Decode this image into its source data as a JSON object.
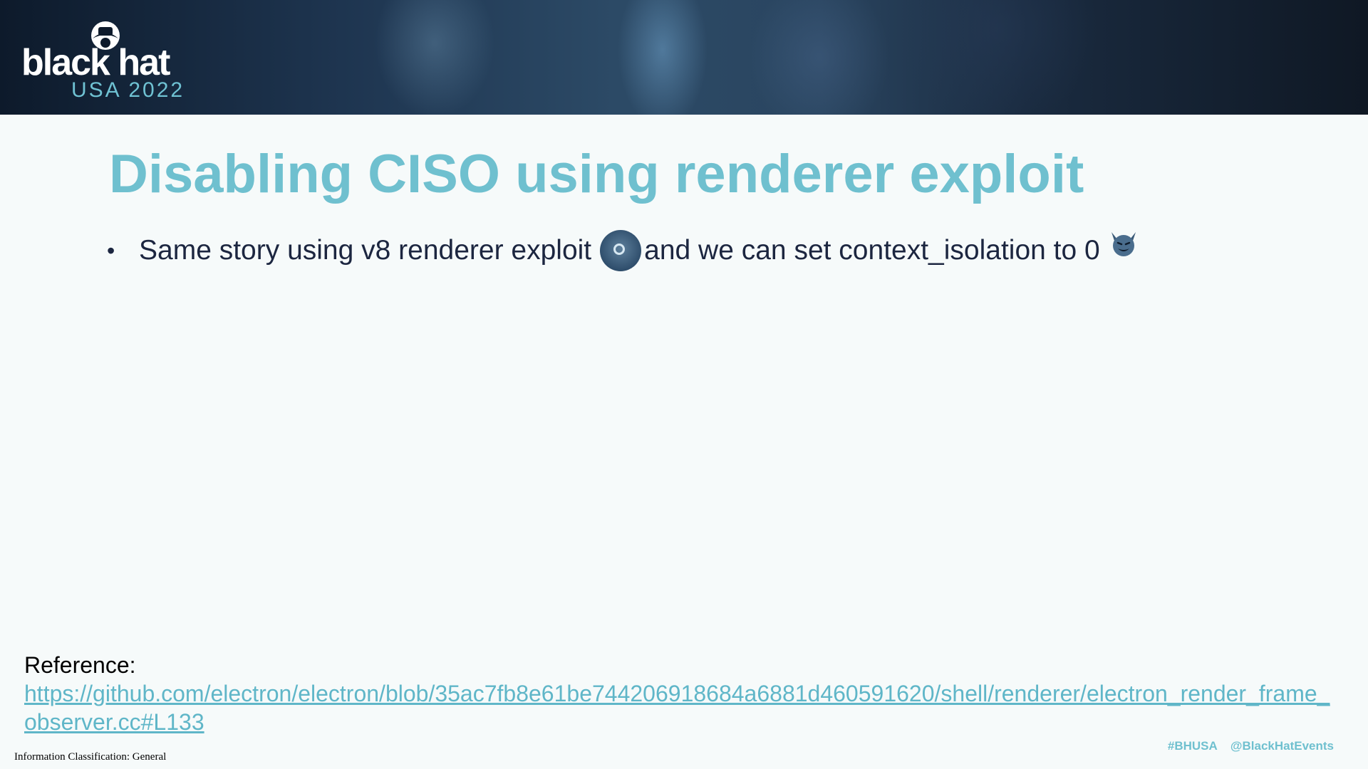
{
  "banner": {
    "logo_word": "black hat",
    "logo_sub": "USA 2022"
  },
  "slide": {
    "title": "Disabling CISO using renderer exploit",
    "bullet": {
      "text_before": "Same story using v8 renderer exploit",
      "text_after": "and we can set context_isolation to 0",
      "icons": [
        "record-button-icon",
        "smiling-devil-icon"
      ]
    },
    "reference_label": "Reference:",
    "reference_url": "https://github.com/electron/electron/blob/35ac7fb8e61be744206918684a6881d460591620/shell/renderer/electron_render_frame_observer.cc#L133"
  },
  "footer": {
    "classification": "Information Classification: General",
    "hashtag": "#BHUSA",
    "handle": "@BlackHatEvents"
  },
  "colors": {
    "title": "#6fc0cf",
    "link": "#5fb6c8",
    "banner_dark": "#0d1a2b"
  }
}
